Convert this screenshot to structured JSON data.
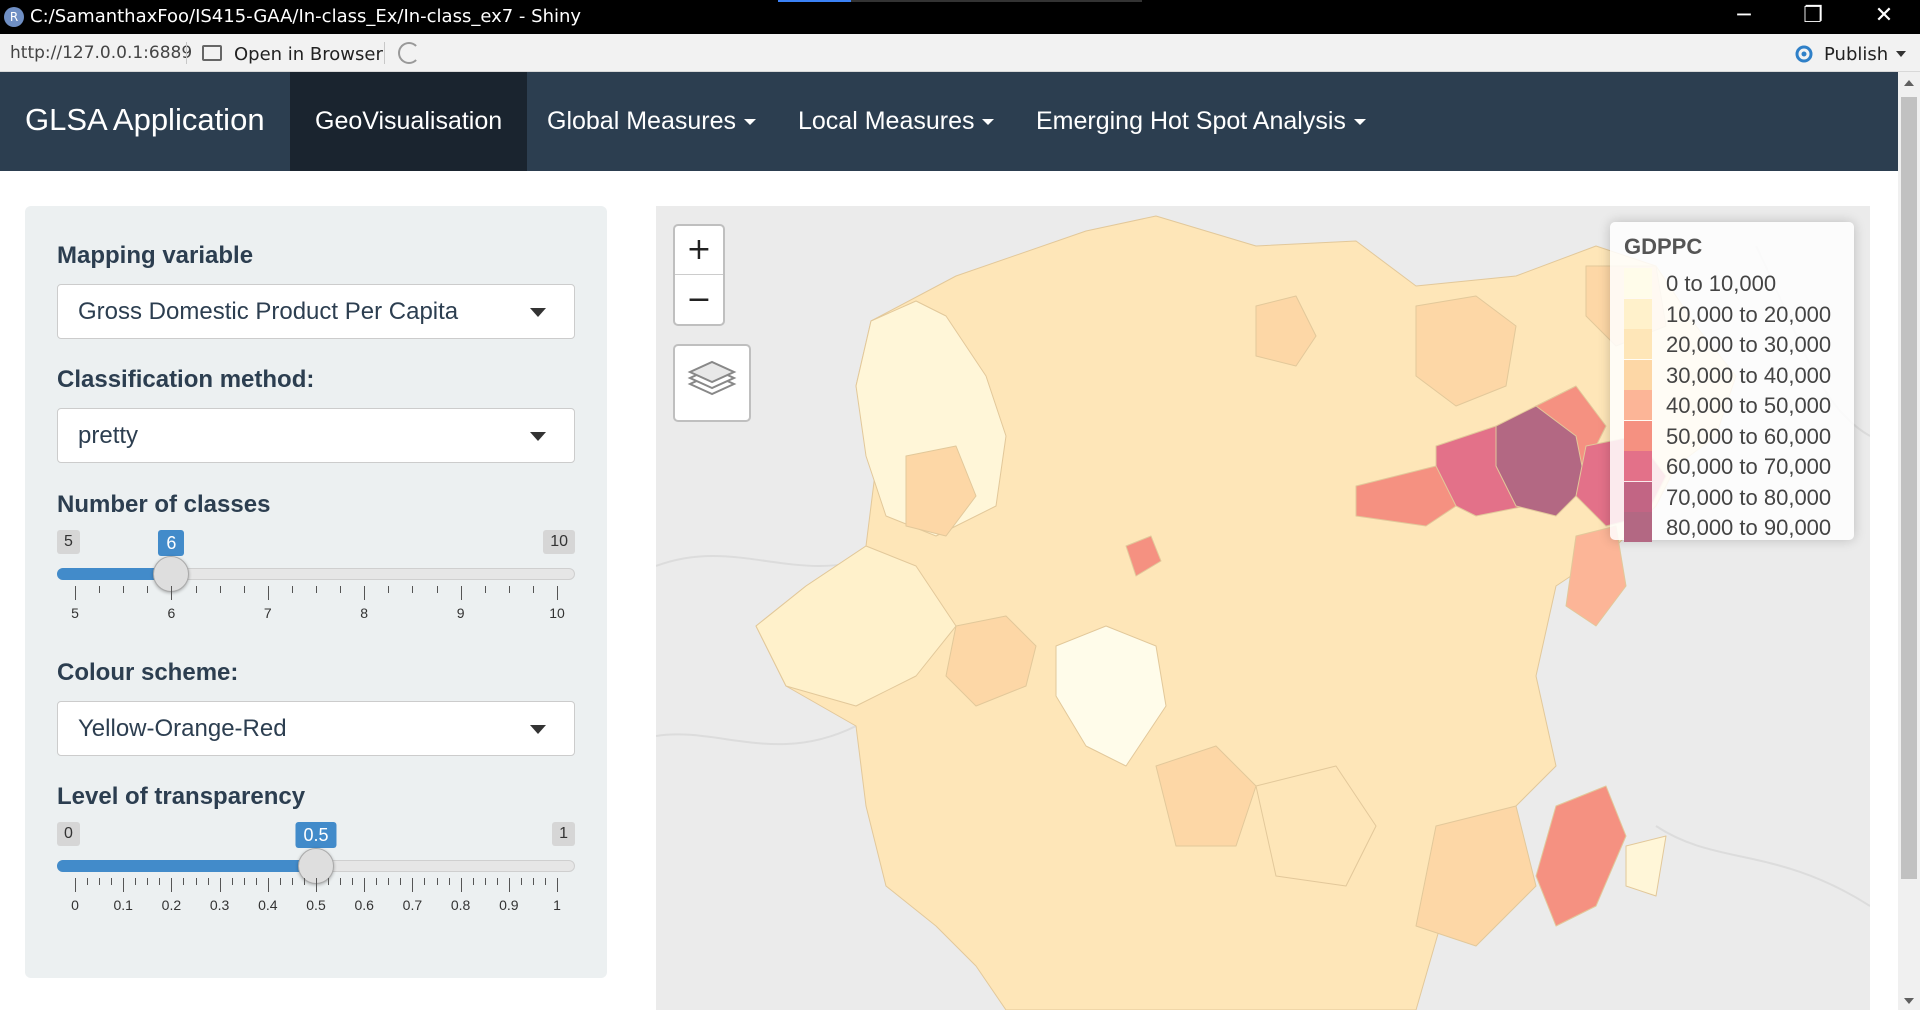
{
  "window": {
    "title": "C:/SamanthaxFoo/IS415-GAA/In-class_Ex/In-class_ex7 - Shiny",
    "app_icon_letter": "R",
    "minimize": "─",
    "restore": "❐",
    "close": "✕"
  },
  "addressbar": {
    "url": "http://127.0.0.1:6889",
    "open_in_browser": "Open in Browser",
    "publish": "Publish"
  },
  "navbar": {
    "brand": "GLSA Application",
    "tabs": [
      {
        "label": "GeoVisualisation",
        "active": true,
        "dropdown": false
      },
      {
        "label": "Global Measures",
        "active": false,
        "dropdown": true
      },
      {
        "label": "Local Measures",
        "active": false,
        "dropdown": true
      },
      {
        "label": "Emerging Hot Spot Analysis",
        "active": false,
        "dropdown": true
      }
    ]
  },
  "sidebar": {
    "mapping_variable": {
      "label": "Mapping variable",
      "value": "Gross Domestic Product Per Capita"
    },
    "classification": {
      "label": "Classification method:",
      "value": "pretty"
    },
    "classes": {
      "label": "Number of classes",
      "min": 5,
      "max": 10,
      "value": 6,
      "ticks": [
        "5",
        "6",
        "7",
        "8",
        "9",
        "10"
      ],
      "min_label": "5",
      "max_label": "10",
      "value_label": "6"
    },
    "colour_scheme": {
      "label": "Colour scheme:",
      "value": "Yellow-Orange-Red"
    },
    "transparency": {
      "label": "Level of transparency",
      "min": 0,
      "max": 1,
      "value": 0.5,
      "ticks": [
        "0",
        "0.1",
        "0.2",
        "0.3",
        "0.4",
        "0.5",
        "0.6",
        "0.7",
        "0.8",
        "0.9",
        "1"
      ],
      "min_label": "0",
      "max_label": "1",
      "value_label": "0.5"
    }
  },
  "map": {
    "zoom_in": "+",
    "zoom_out": "−",
    "legend": {
      "title": "GDPPC",
      "entries": [
        {
          "label": "0 to 10,000",
          "color": "#fffcea"
        },
        {
          "label": "10,000 to 20,000",
          "color": "#fff1cb"
        },
        {
          "label": "20,000 to 30,000",
          "color": "#fee6b8"
        },
        {
          "label": "30,000 to 40,000",
          "color": "#fdd7a6"
        },
        {
          "label": "40,000 to 50,000",
          "color": "#fcb597"
        },
        {
          "label": "50,000 to 60,000",
          "color": "#f59181"
        },
        {
          "label": "60,000 to 70,000",
          "color": "#e37189"
        },
        {
          "label": "70,000 to 80,000",
          "color": "#c26584"
        },
        {
          "label": "80,000 to 90,000",
          "color": "#b36883"
        }
      ]
    }
  }
}
